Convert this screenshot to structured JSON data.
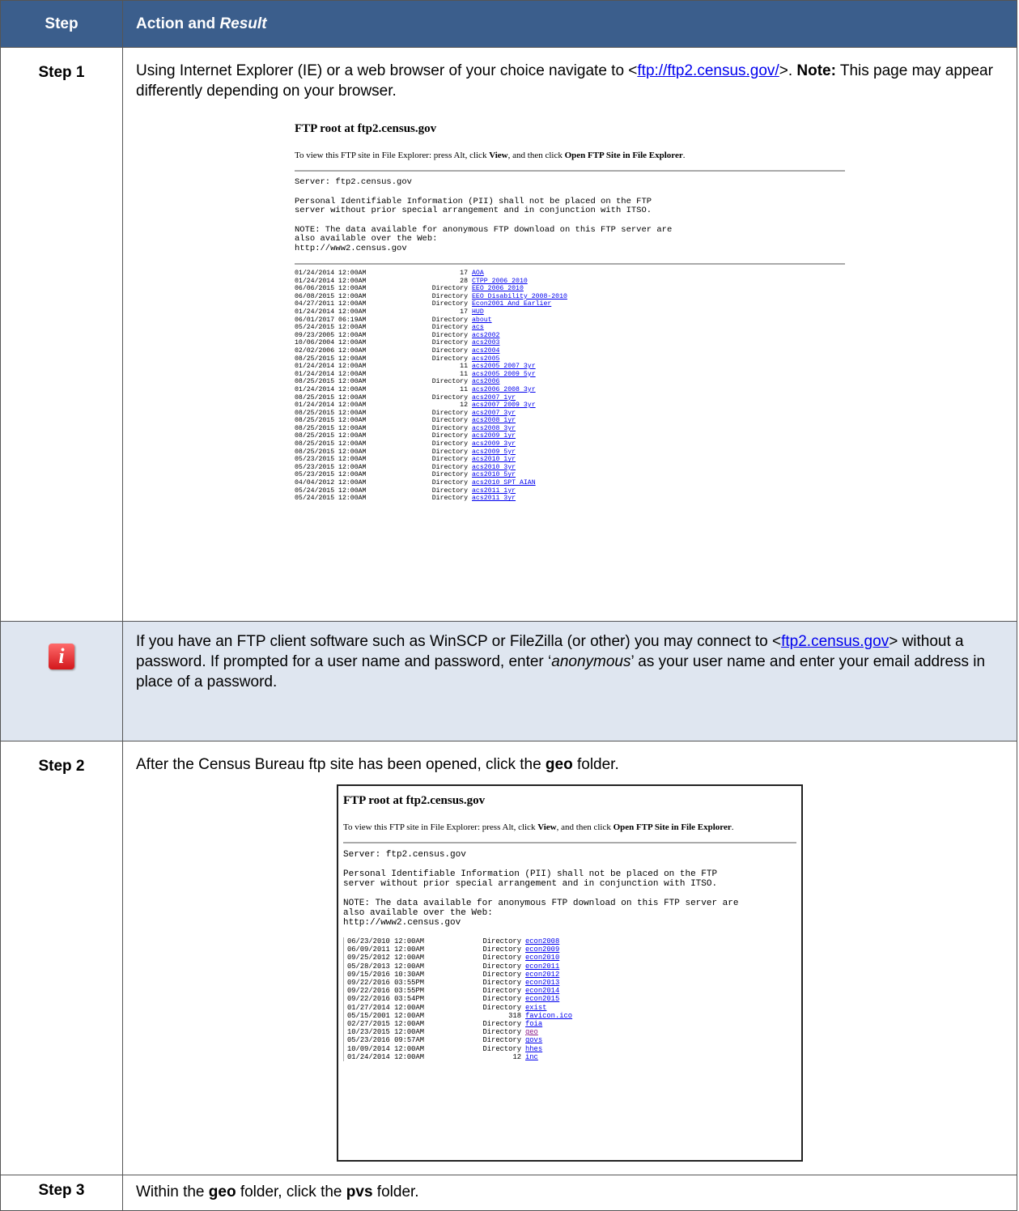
{
  "header": {
    "step": "Step",
    "action": "Action and ",
    "result": "Result"
  },
  "step1": {
    "label": "Step 1",
    "text_a": "Using Internet Explorer (IE) or a web browser of your choice navigate to <",
    "link": "ftp://ftp2.census.gov/",
    "text_b": ">. ",
    "note_label": "Note:",
    "text_c": "  This page may appear differently depending on your browser."
  },
  "ftp1": {
    "title": "FTP root at ftp2.census.gov",
    "instr_a": "To view this FTP site in File Explorer: press Alt, click ",
    "instr_view": "View",
    "instr_b": ", and then click ",
    "instr_open": "Open FTP Site in File Explorer",
    "instr_c": ".",
    "server": "Server: ftp2.census.gov",
    "pii": "Personal Identifiable Information (PII) shall not be placed on the FTP\nserver without prior special arrangement and in conjunction with ITSO.",
    "note": "NOTE: The data available for anonymous FTP download on this FTP server are\nalso available over the Web:\nhttp://www2.census.gov",
    "rows": [
      {
        "date": "01/24/2014 12:00AM",
        "size": "17",
        "name": "AOA"
      },
      {
        "date": "01/24/2014 12:00AM",
        "size": "28",
        "name": "CTPP 2006 2010"
      },
      {
        "date": "06/06/2015 12:00AM",
        "size": "Directory",
        "name": "EEO 2006 2010"
      },
      {
        "date": "06/08/2015 12:00AM",
        "size": "Directory",
        "name": "EEO Disability 2008-2010"
      },
      {
        "date": "04/27/2011 12:00AM",
        "size": "Directory",
        "name": "Econ2001 And Earlier"
      },
      {
        "date": "01/24/2014 12:00AM",
        "size": "17",
        "name": "HUD"
      },
      {
        "date": "06/01/2017 06:19AM",
        "size": "Directory",
        "name": "about"
      },
      {
        "date": "05/24/2015 12:00AM",
        "size": "Directory",
        "name": "acs"
      },
      {
        "date": "09/23/2005 12:00AM",
        "size": "Directory",
        "name": "acs2002"
      },
      {
        "date": "10/06/2004 12:00AM",
        "size": "Directory",
        "name": "acs2003"
      },
      {
        "date": "02/02/2006 12:00AM",
        "size": "Directory",
        "name": "acs2004"
      },
      {
        "date": "08/25/2015 12:00AM",
        "size": "Directory",
        "name": "acs2005"
      },
      {
        "date": "01/24/2014 12:00AM",
        "size": "11",
        "name": "acs2005 2007 3yr"
      },
      {
        "date": "01/24/2014 12:00AM",
        "size": "11",
        "name": "acs2005 2009 5yr"
      },
      {
        "date": "08/25/2015 12:00AM",
        "size": "Directory",
        "name": "acs2006"
      },
      {
        "date": "01/24/2014 12:00AM",
        "size": "11",
        "name": "acs2006 2008 3yr"
      },
      {
        "date": "08/25/2015 12:00AM",
        "size": "Directory",
        "name": "acs2007 1yr"
      },
      {
        "date": "01/24/2014 12:00AM",
        "size": "12",
        "name": "acs2007 2009 3yr"
      },
      {
        "date": "08/25/2015 12:00AM",
        "size": "Directory",
        "name": "acs2007 3yr"
      },
      {
        "date": "08/25/2015 12:00AM",
        "size": "Directory",
        "name": "acs2008 1yr"
      },
      {
        "date": "08/25/2015 12:00AM",
        "size": "Directory",
        "name": "acs2008 3yr"
      },
      {
        "date": "08/25/2015 12:00AM",
        "size": "Directory",
        "name": "acs2009 1yr"
      },
      {
        "date": "08/25/2015 12:00AM",
        "size": "Directory",
        "name": "acs2009 3yr"
      },
      {
        "date": "08/25/2015 12:00AM",
        "size": "Directory",
        "name": "acs2009 5yr"
      },
      {
        "date": "05/23/2015 12:00AM",
        "size": "Directory",
        "name": "acs2010 1yr"
      },
      {
        "date": "05/23/2015 12:00AM",
        "size": "Directory",
        "name": "acs2010 3yr"
      },
      {
        "date": "05/23/2015 12:00AM",
        "size": "Directory",
        "name": "acs2010 5yr"
      },
      {
        "date": "04/04/2012 12:00AM",
        "size": "Directory",
        "name": "acs2010 SPT AIAN"
      },
      {
        "date": "05/24/2015 12:00AM",
        "size": "Directory",
        "name": "acs2011 1yr"
      },
      {
        "date": "05/24/2015 12:00AM",
        "size": "Directory",
        "name": "acs2011 3yr"
      }
    ]
  },
  "note": {
    "text_a": "If you have an FTP client software such as WinSCP or FileZilla (or other) you may connect to <",
    "link": "ftp2.census.gov",
    "text_b": "> without a password. If prompted for a user name and password, enter ‘",
    "anon": "anonymous",
    "text_c": "’ as your user name and enter your email address in place of a password."
  },
  "step2": {
    "label": "Step 2",
    "text_a": "After the Census Bureau ftp site has been opened, click the ",
    "bold": "geo",
    "text_b": " folder."
  },
  "ftp2": {
    "title": "FTP root at ftp2.census.gov",
    "instr_a": "To view this FTP site in File Explorer: press Alt, click ",
    "instr_view": "View",
    "instr_b": ", and then click ",
    "instr_open": "Open FTP Site in File Explorer",
    "instr_c": ".",
    "server": "Server: ftp2.census.gov",
    "pii": "Personal Identifiable Information (PII) shall not be placed on the FTP\nserver without prior special arrangement and in conjunction with ITSO.",
    "note": "NOTE: The data available for anonymous FTP download on this FTP server are\nalso available over the Web:\nhttp://www2.census.gov",
    "rows": [
      {
        "date": "06/23/2010 12:00AM",
        "size": "Directory",
        "name": "econ2008",
        "visited": false
      },
      {
        "date": "06/09/2011 12:00AM",
        "size": "Directory",
        "name": "econ2009",
        "visited": false
      },
      {
        "date": "09/25/2012 12:00AM",
        "size": "Directory",
        "name": "econ2010",
        "visited": false
      },
      {
        "date": "05/28/2013 12:00AM",
        "size": "Directory",
        "name": "econ2011",
        "visited": false
      },
      {
        "date": "09/15/2016 10:30AM",
        "size": "Directory",
        "name": "econ2012",
        "visited": false
      },
      {
        "date": "09/22/2016 03:55PM",
        "size": "Directory",
        "name": "econ2013",
        "visited": false
      },
      {
        "date": "09/22/2016 03:55PM",
        "size": "Directory",
        "name": "econ2014",
        "visited": false
      },
      {
        "date": "09/22/2016 03:54PM",
        "size": "Directory",
        "name": "econ2015",
        "visited": false
      },
      {
        "date": "01/27/2014 12:00AM",
        "size": "Directory",
        "name": "exist",
        "visited": false
      },
      {
        "date": "05/15/2001 12:00AM",
        "size": "318",
        "name": "favicon.ico",
        "visited": false
      },
      {
        "date": "02/27/2015 12:00AM",
        "size": "Directory",
        "name": "foia",
        "visited": false
      },
      {
        "date": "10/23/2015 12:00AM",
        "size": "Directory",
        "name": "geo",
        "visited": true
      },
      {
        "date": "05/23/2016 09:57AM",
        "size": "Directory",
        "name": "govs",
        "visited": false
      },
      {
        "date": "10/09/2014 12:00AM",
        "size": "Directory",
        "name": "hhes",
        "visited": false
      },
      {
        "date": "01/24/2014 12:00AM",
        "size": "12",
        "name": "inc",
        "visited": false
      }
    ]
  },
  "step3": {
    "label": "Step 3",
    "text_a": "Within the ",
    "bold1": "geo",
    "text_b": " folder, click the ",
    "bold2": "pvs",
    "text_c": " folder."
  }
}
